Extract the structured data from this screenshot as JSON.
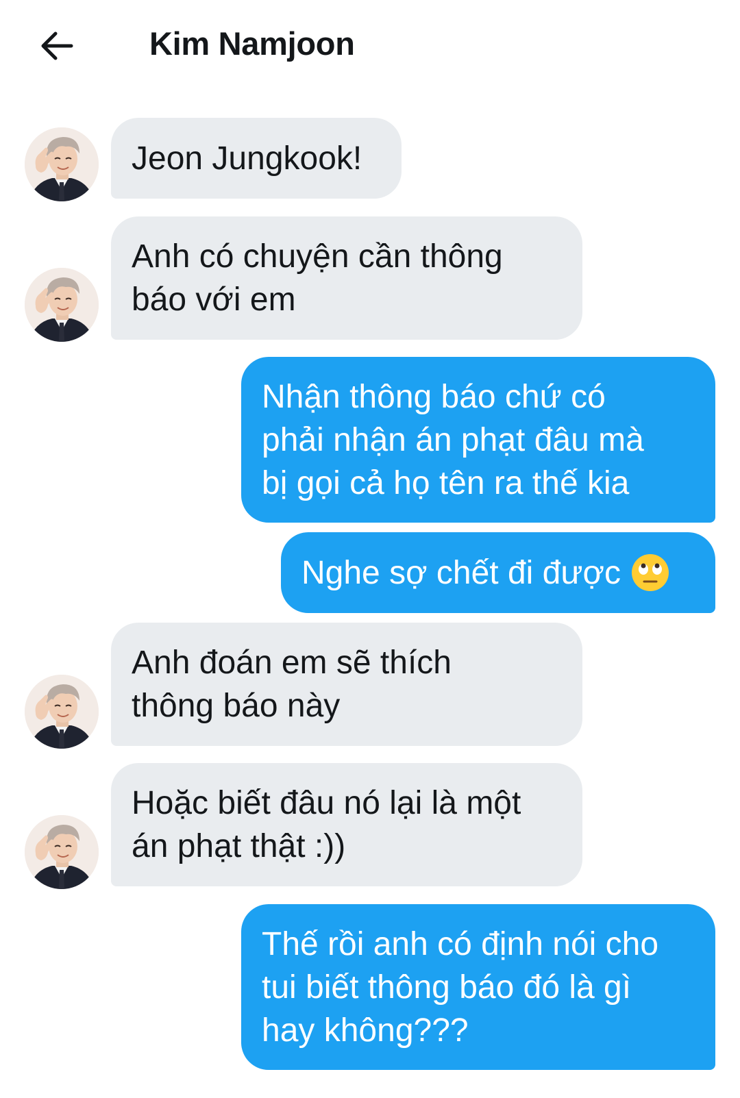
{
  "header": {
    "title": "Kim Namjoon",
    "back_icon": "arrow-left-icon"
  },
  "colors": {
    "incoming_bubble": "#e9ecef",
    "outgoing_bubble": "#1da1f2"
  },
  "messages": [
    {
      "direction": "in",
      "text": "Jeon Jungkook!"
    },
    {
      "direction": "in",
      "text": "Anh có chuyện cần thông\nbáo với em"
    },
    {
      "direction": "out",
      "text": "Nhận thông báo chứ có\nphải nhận án phạt đâu mà\nbị gọi cả họ tên ra thế kia"
    },
    {
      "direction": "out",
      "text": "Nghe sợ chết đi được",
      "emoji": "face-with-rolling-eyes-emoji"
    },
    {
      "direction": "in",
      "text": "Anh đoán em sẽ thích\nthông báo này"
    },
    {
      "direction": "in",
      "text": "Hoặc biết đâu nó lại là một\nán phạt thật :))"
    },
    {
      "direction": "out",
      "text": "Thế rồi anh có định nói cho\ntui biết thông báo đó là gì\nhay không???"
    }
  ]
}
